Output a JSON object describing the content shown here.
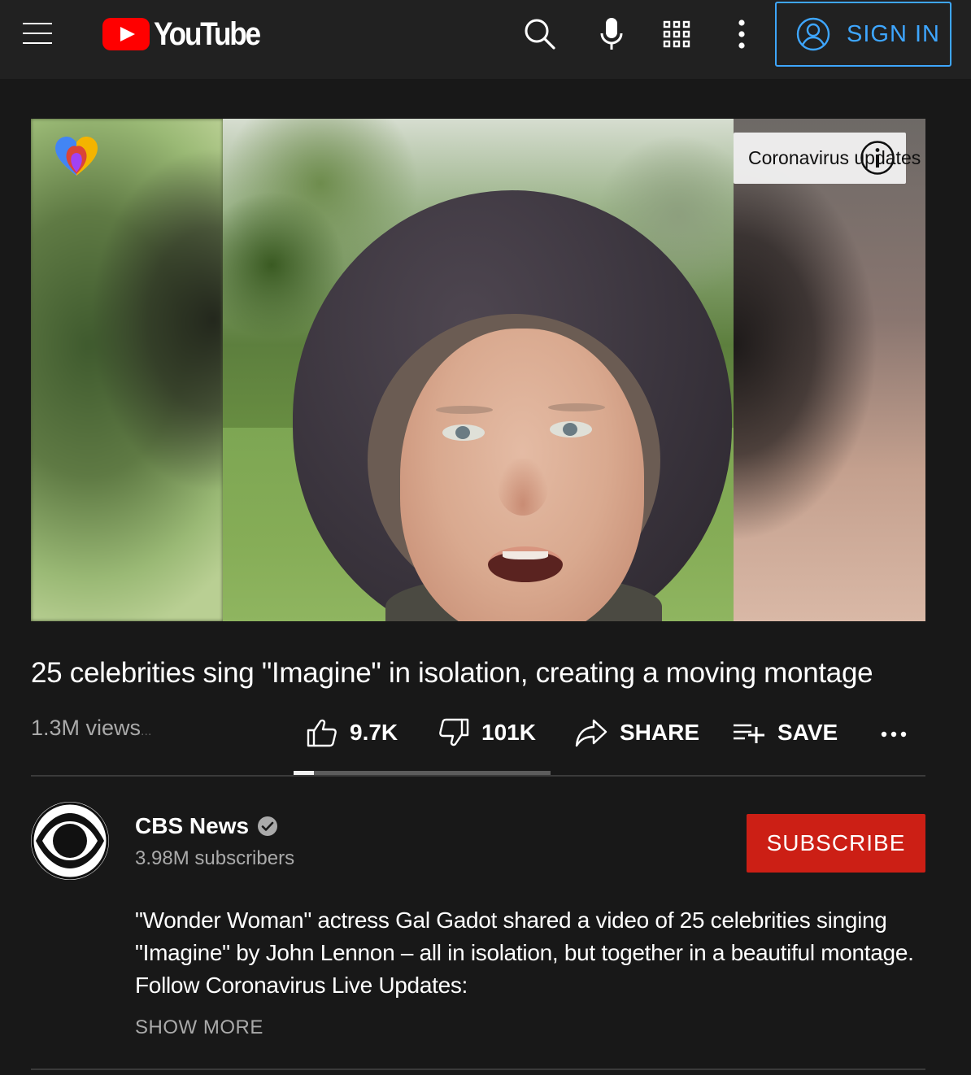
{
  "header": {
    "logo_text": "YouTube",
    "signin_label": "SIGN IN",
    "icons": [
      "menu-icon",
      "search-icon",
      "mic-icon",
      "apps-icon",
      "more-vert-icon",
      "account-icon"
    ],
    "accent_color": "#3ea6ff",
    "brand_color": "#ff0000"
  },
  "video": {
    "info_banner": "Coronavirus updates",
    "icons": [
      "health-logo-icon",
      "info-icon"
    ]
  },
  "watch": {
    "title": "25 celebrities sing \"Imagine\" in isolation, creating a moving montage",
    "views": "1.3M views",
    "views_ellipsis": "...",
    "like_count": "9.7K",
    "dislike_count": "101K",
    "share_label": "SHARE",
    "save_label": "SAVE",
    "like_ratio": 0.08
  },
  "channel": {
    "name": "CBS News",
    "verified": true,
    "subscribers": "3.98M subscribers",
    "subscribe_label": "SUBSCRIBE",
    "subscribe_color": "#cc1f15"
  },
  "description": {
    "text": "\"Wonder Woman\" actress Gal Gadot shared a video of 25 celebrities singing \"Imagine\" by John Lennon – all in isolation, but together in a beautiful montage. Follow Coronavirus Live Updates:",
    "show_more_label": "SHOW MORE"
  }
}
